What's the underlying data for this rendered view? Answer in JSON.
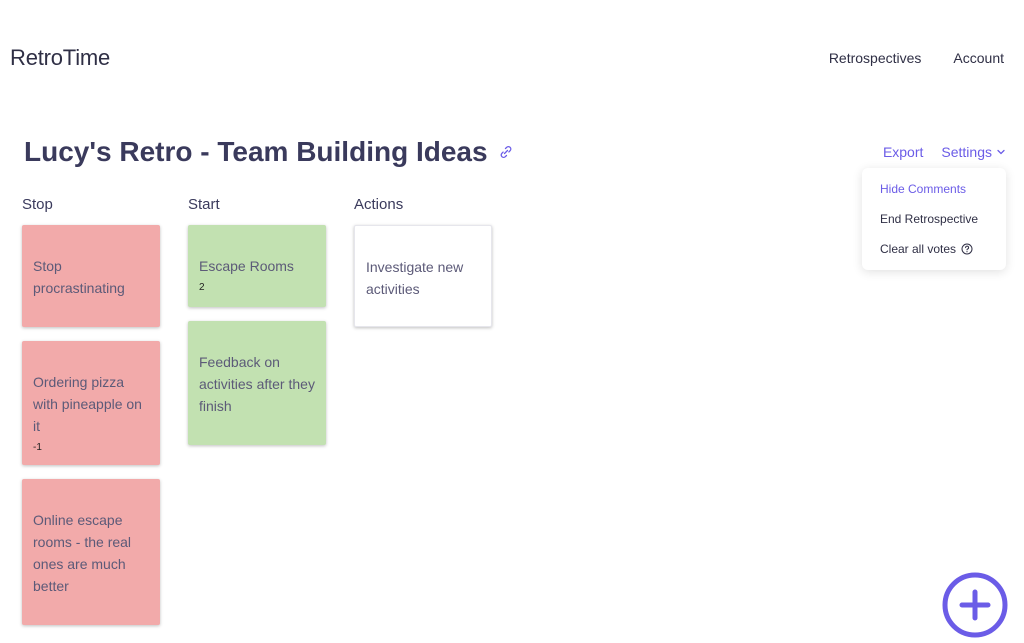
{
  "nav": {
    "brand": "RetroTime",
    "links": [
      "Retrospectives",
      "Account"
    ]
  },
  "page": {
    "title": "Lucy's Retro - Team Building Ideas",
    "export_label": "Export",
    "settings_label": "Settings"
  },
  "settings_menu": {
    "items": [
      "Hide Comments",
      "End Retrospective",
      "Clear all votes"
    ]
  },
  "columns": [
    {
      "title": "Stop",
      "cards": [
        {
          "text": "Stop procrastinating",
          "votes": ""
        },
        {
          "text": "Ordering pizza with pineapple on it",
          "votes": "-1"
        },
        {
          "text": "Online escape rooms - the real ones are much better",
          "votes": ""
        }
      ]
    },
    {
      "title": "Start",
      "cards": [
        {
          "text": "Escape Rooms",
          "votes": "2"
        },
        {
          "text": "Feedback on activities after they finish",
          "votes": ""
        }
      ]
    },
    {
      "title": "Actions",
      "cards": [
        {
          "text": "Investigate new activities",
          "votes": ""
        }
      ]
    }
  ],
  "colors": {
    "accent": "#6b5ce7",
    "stop_card": "#f2aaaa",
    "start_card": "#c2e1b1",
    "action_card": "#ffffff"
  },
  "icons": {
    "title_link": "link-icon",
    "settings_chevron": "chevron-down-icon",
    "clear_votes_help": "help-circle-icon",
    "fab": "plus-circle-icon"
  }
}
